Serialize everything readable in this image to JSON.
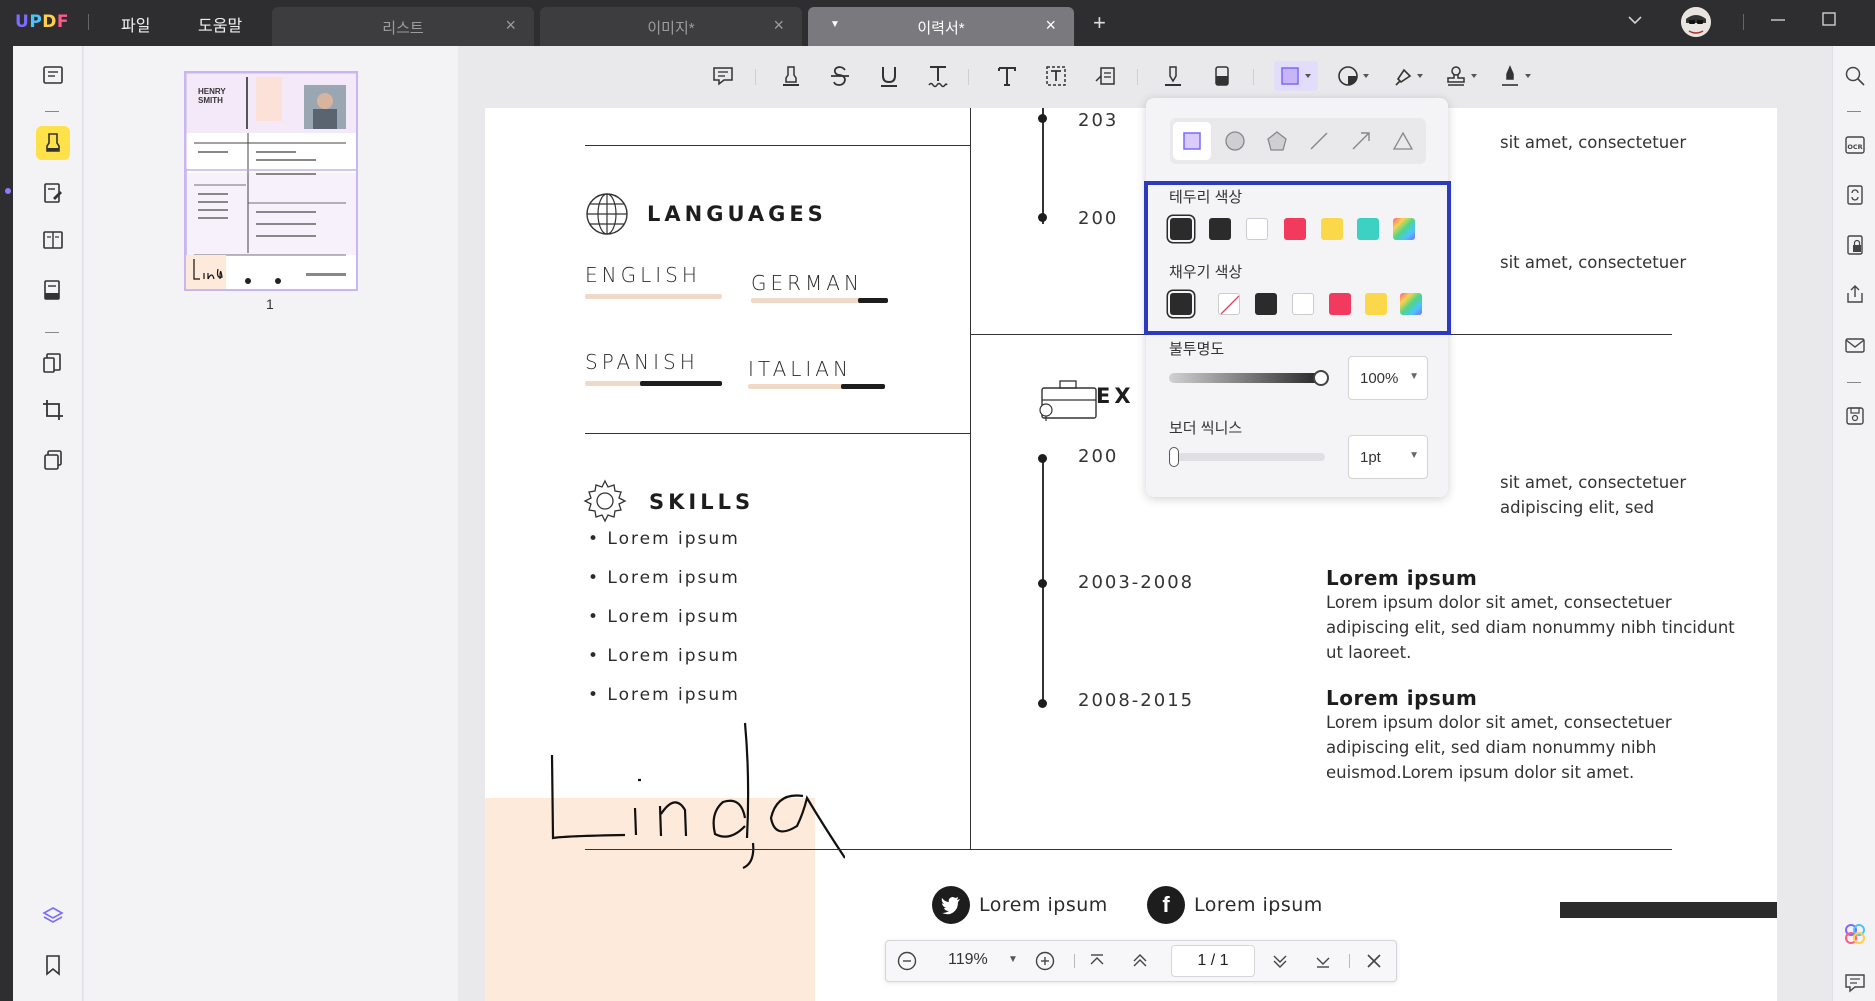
{
  "app": {
    "logo": "UPDF",
    "menu": [
      "파일",
      "도움말"
    ]
  },
  "tabs": [
    {
      "label": "리스트"
    },
    {
      "label": "이미지*"
    },
    {
      "label": "이력서*"
    }
  ],
  "thumbnail": {
    "page_number": "1",
    "mini_name": "HENRY SMITH"
  },
  "resume": {
    "languages_title": "LANGUAGES",
    "languages": [
      {
        "name": "ENGLISH",
        "level": 0.0
      },
      {
        "name": "GERMAN",
        "level": 0.22
      },
      {
        "name": "SPANISH",
        "level": 0.6
      },
      {
        "name": "ITALIAN",
        "level": 0.32
      }
    ],
    "skills_title": "SKILLS",
    "skills": [
      "• Lorem ipsum",
      "• Lorem ipsum",
      "• Lorem ipsum",
      "• Lorem ipsum",
      "• Lorem ipsum"
    ],
    "experience_title": "EX",
    "top_years": [
      "203",
      "200"
    ],
    "top_desc": [
      "sit amet, consectetuer",
      "sit amet, consectetuer"
    ],
    "exp_top": {
      "year": "200",
      "desc": "sit amet, consectetuer\nadipiscing elit, sed"
    },
    "jobs": [
      {
        "year": "2003-2008",
        "title": "Lorem ipsum",
        "desc": "Lorem ipsum dolor sit amet, consectetuer adipiscing elit, sed diam nonummy nibh tincidunt ut laoreet."
      },
      {
        "year": "2008-2015",
        "title": "Lorem ipsum",
        "desc": "Lorem ipsum dolor sit amet, consectetuer adipiscing elit, sed diam nonummy nibh euismod.Lorem ipsum dolor sit amet."
      }
    ],
    "social": [
      {
        "icon": "twitter-icon",
        "label": "Lorem ipsum"
      },
      {
        "icon": "facebook-icon",
        "label": "Lorem ipsum"
      }
    ],
    "signature": "Linda"
  },
  "shape_popup": {
    "shapes": [
      "rectangle",
      "circle",
      "polygon",
      "line",
      "arrow",
      "triangle"
    ],
    "border_color_label": "테두리 색상",
    "fill_color_label": "채우기 색상",
    "border_colors": [
      "#2b2b2b",
      "#2b2b2b",
      "#ffffff",
      "#f2395e",
      "#fad84a",
      "#3dd1c4",
      "gradient"
    ],
    "fill_colors": [
      "#2b2b2b",
      "none",
      "#2b2b2b",
      "#ffffff",
      "#f2395e",
      "#fad84a",
      "gradient"
    ],
    "opacity_label": "불투명도",
    "opacity_value": "100%",
    "thickness_label": "보더 씩니스",
    "thickness_value": "1pt"
  },
  "bottom_nav": {
    "zoom": "119%",
    "page_current": "1",
    "page_sep": "/",
    "page_total": "1"
  },
  "colors": {
    "accent": "#7b6bff",
    "highlight_box": "#2c3bbd",
    "active_tool": "#ffe24a"
  }
}
